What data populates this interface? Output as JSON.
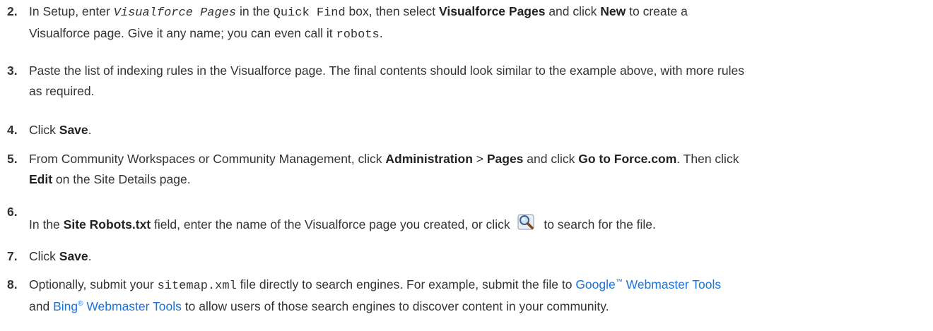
{
  "steps": [
    {
      "num": "2.",
      "parts": {
        "a": "In Setup, enter ",
        "code1": "Visualforce Pages",
        "b": " in the ",
        "code2": "Quick Find",
        "c": " box, then select ",
        "bold1": "Visualforce Pages",
        "d": " and click ",
        "bold2": "New",
        "e": " to create a",
        "f": "Visualforce page. Give it any name; you can even call it ",
        "code3": "robots",
        "g": "."
      }
    },
    {
      "num": "3.",
      "line1": "Paste the list of indexing rules in the Visualforce page. The final contents should look similar to the example above, with more rules",
      "line2": "as required."
    },
    {
      "num": "4.",
      "a": "Click ",
      "bold": "Save",
      "b": "."
    },
    {
      "num": "5.",
      "a": "From Community Workspaces or Community Management, click ",
      "bold1": "Administration",
      "b": " > ",
      "bold2": "Pages",
      "c": " and click ",
      "bold3": "Go to Force.com",
      "d": ". Then click",
      "bold4": "Edit",
      "e": " on the Site Details page."
    },
    {
      "num": "6.",
      "a": "In the ",
      "bold": "Site Robots.txt",
      "b": " field, enter the name of the Visualforce page you created, or click",
      "c": "to search for the file.",
      "icon": "lookup-magnifier-icon"
    },
    {
      "num": "7.",
      "a": "Click ",
      "bold": "Save",
      "b": "."
    },
    {
      "num": "8.",
      "a": "Optionally, submit your ",
      "code": "sitemap.xml",
      "b": " file directly to search engines. For example, submit the file to ",
      "link1": "Google",
      "tm": "™",
      "link1b": " Webmaster Tools",
      "c": "and ",
      "link2": "Bing",
      "reg": "®",
      "link2b": " Webmaster Tools",
      "d": " to allow users of those search engines to discover content in your community."
    }
  ],
  "colors": {
    "text": "#333333",
    "link": "#1a73d9"
  }
}
